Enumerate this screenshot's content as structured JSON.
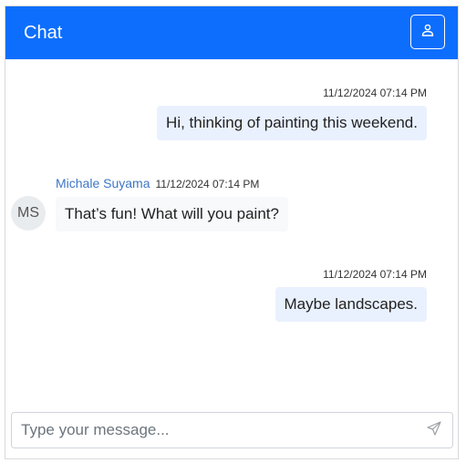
{
  "header": {
    "title": "Chat",
    "profile_icon": "user-icon",
    "color": "#0d6efd"
  },
  "messages": [
    {
      "direction": "outgoing",
      "timestamp": "11/12/2024 07:14 PM",
      "text": "Hi, thinking of painting this weekend."
    },
    {
      "direction": "incoming",
      "author": "Michale Suyama",
      "initials": "MS",
      "timestamp": "11/12/2024 07:14 PM",
      "text": "That’s fun! What will you paint?"
    },
    {
      "direction": "outgoing",
      "timestamp": "11/12/2024 07:14 PM",
      "text": "Maybe landscapes."
    }
  ],
  "composer": {
    "placeholder": "Type your message...",
    "value": "",
    "send_icon": "send-icon"
  }
}
